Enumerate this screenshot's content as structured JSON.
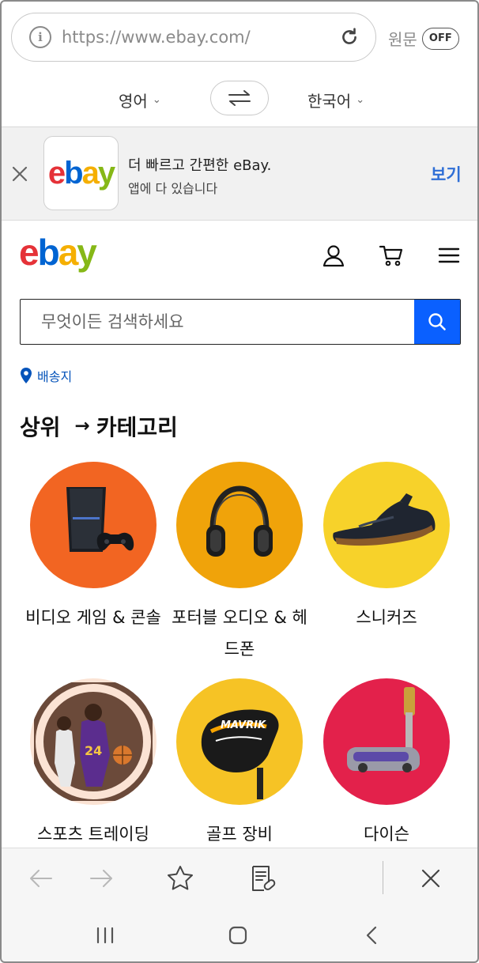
{
  "browser": {
    "url": "https://www.ebay.com/",
    "original_label": "원문",
    "original_toggle": "OFF"
  },
  "translate": {
    "source_lang": "영어",
    "target_lang": "한국어"
  },
  "app_banner": {
    "title": "더 빠르고 간편한 eBay.",
    "subtitle": "앱에 다 있습니다",
    "view_label": "보기"
  },
  "logo": {
    "e": "e",
    "b": "b",
    "a": "a",
    "y": "y"
  },
  "search": {
    "placeholder": "무엇이든 검색하세요"
  },
  "ship_to": {
    "label": "배송지"
  },
  "section": {
    "title_left": "상위",
    "title_right": "카테고리",
    "arrow": "→"
  },
  "categories": [
    {
      "label": "비디오 게임 & 콘솔",
      "bg": "#f26522",
      "icon": "game-console"
    },
    {
      "label": "포터블 오디오 & 헤드폰",
      "bg": "#f0a30a",
      "icon": "headphones"
    },
    {
      "label": "스니커즈",
      "bg": "#f7d22a",
      "icon": "sneaker"
    },
    {
      "label": "스포츠 트레이딩",
      "bg": "#fbe3d4",
      "icon": "basketball-card"
    },
    {
      "label": "골프 장비",
      "bg": "#f6c325",
      "icon": "golf-club"
    },
    {
      "label": "다이슨",
      "bg": "#e3214b",
      "icon": "vacuum"
    }
  ],
  "colors": {
    "accent_blue": "#0a60ff",
    "link_blue": "#0654ba",
    "banner_blue": "#2f6fd6",
    "ebay_red": "#e53238",
    "ebay_blue": "#0064d2",
    "ebay_yellow": "#f5af02",
    "ebay_green": "#86b817"
  }
}
